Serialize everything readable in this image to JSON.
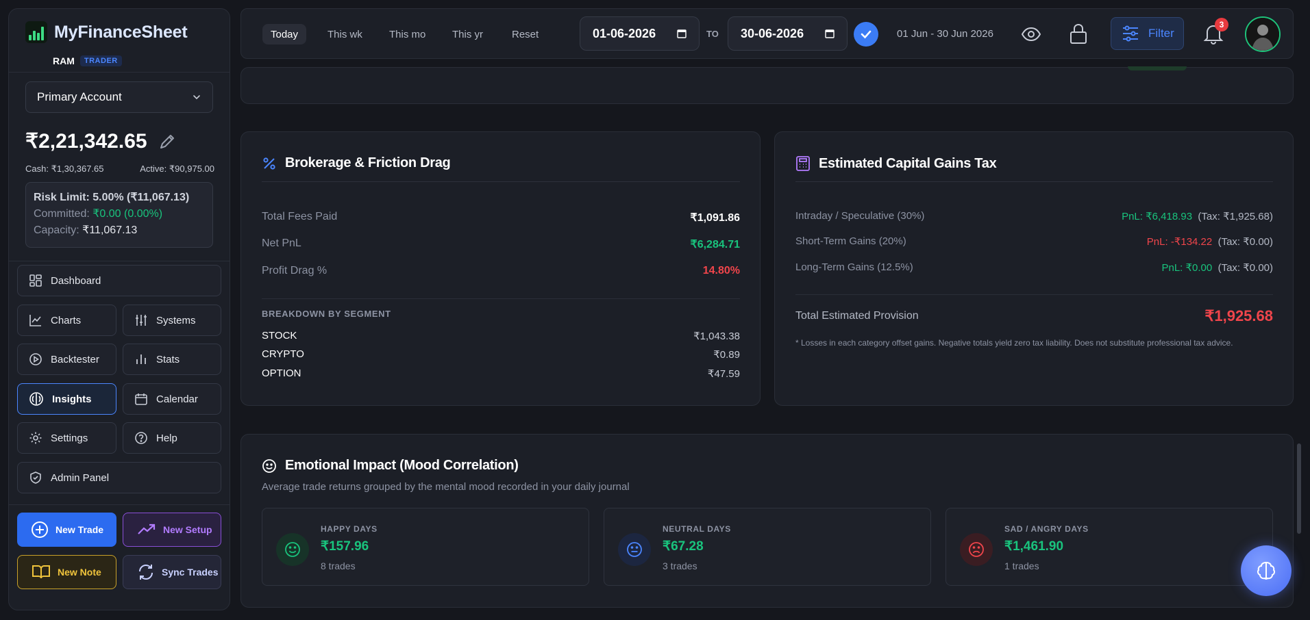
{
  "brand": {
    "title": "MyFinanceSheet",
    "user": "RAM",
    "role": "TRADER"
  },
  "account": {
    "selected": "Primary Account",
    "balance": "₹2,21,342.65",
    "cash": "Cash: ₹1,30,367.65",
    "active": "Active: ₹90,975.00"
  },
  "risk": {
    "limit": "Risk Limit: 5.00% (₹11,067.13)",
    "committed_label": "Committed:",
    "committed_value": "₹0.00 (0.00%)",
    "capacity_label": "Capacity:",
    "capacity_value": "₹11,067.13"
  },
  "nav": {
    "dashboard": "Dashboard",
    "charts": "Charts",
    "systems": "Systems",
    "backtester": "Backtester",
    "stats": "Stats",
    "insights": "Insights",
    "calendar": "Calendar",
    "settings": "Settings",
    "help": "Help",
    "admin": "Admin Panel"
  },
  "actions": {
    "new_trade": "New Trade",
    "new_setup": "New Setup",
    "new_note": "New Note",
    "sync_trades": "Sync Trades"
  },
  "topbar": {
    "tabs": [
      "Today",
      "This wk",
      "This mo",
      "This yr",
      "Reset"
    ],
    "from_date": "01-06-2026",
    "to_label": "TO",
    "to_date": "30-06-2026",
    "range_text": "01 Jun - 30 Jun 2026",
    "filter_label": "Filter",
    "notification_count": "3"
  },
  "brokerage": {
    "title": "Brokerage & Friction Drag",
    "rows": [
      {
        "label": "Total Fees Paid",
        "value": "₹1,091.86"
      },
      {
        "label": "Net PnL",
        "value": "₹6,284.71"
      },
      {
        "label": "Profit Drag %",
        "value": "14.80%"
      }
    ],
    "breakdown_title": "BREAKDOWN BY SEGMENT",
    "segments": [
      {
        "name": "STOCK",
        "value": "₹1,043.38"
      },
      {
        "name": "CRYPTO",
        "value": "₹0.89"
      },
      {
        "name": "OPTION",
        "value": "₹47.59"
      }
    ]
  },
  "tax": {
    "title": "Estimated Capital Gains Tax",
    "rows": [
      {
        "label": "Intraday / Speculative (30%)",
        "pnl": "PnL: ₹6,418.93",
        "tax": "(Tax: ₹1,925.68)"
      },
      {
        "label": "Short-Term Gains (20%)",
        "pnl": "PnL: -₹134.22",
        "tax": "(Tax: ₹0.00)"
      },
      {
        "label": "Long-Term Gains (12.5%)",
        "pnl": "PnL: ₹0.00",
        "tax": "(Tax: ₹0.00)"
      }
    ],
    "total_label": "Total Estimated Provision",
    "total_value": "₹1,925.68",
    "note": "* Losses in each category offset gains. Negative totals yield zero tax liability. Does not substitute professional tax advice."
  },
  "mood": {
    "title": "Emotional Impact (Mood Correlation)",
    "subtitle": "Average trade returns grouped by the mental mood recorded in your daily journal",
    "cards": [
      {
        "label": "HAPPY DAYS",
        "value": "₹157.96",
        "count": "8 trades"
      },
      {
        "label": "NEUTRAL DAYS",
        "value": "₹67.28",
        "count": "3 trades"
      },
      {
        "label": "SAD / ANGRY DAYS",
        "value": "₹1,461.90",
        "count": "1 trades"
      }
    ]
  },
  "colors": {
    "accent": "#4b86ff",
    "positive": "#19c37d",
    "negative": "#f0454b",
    "background": "#15171d",
    "panel": "#1c1f27"
  }
}
